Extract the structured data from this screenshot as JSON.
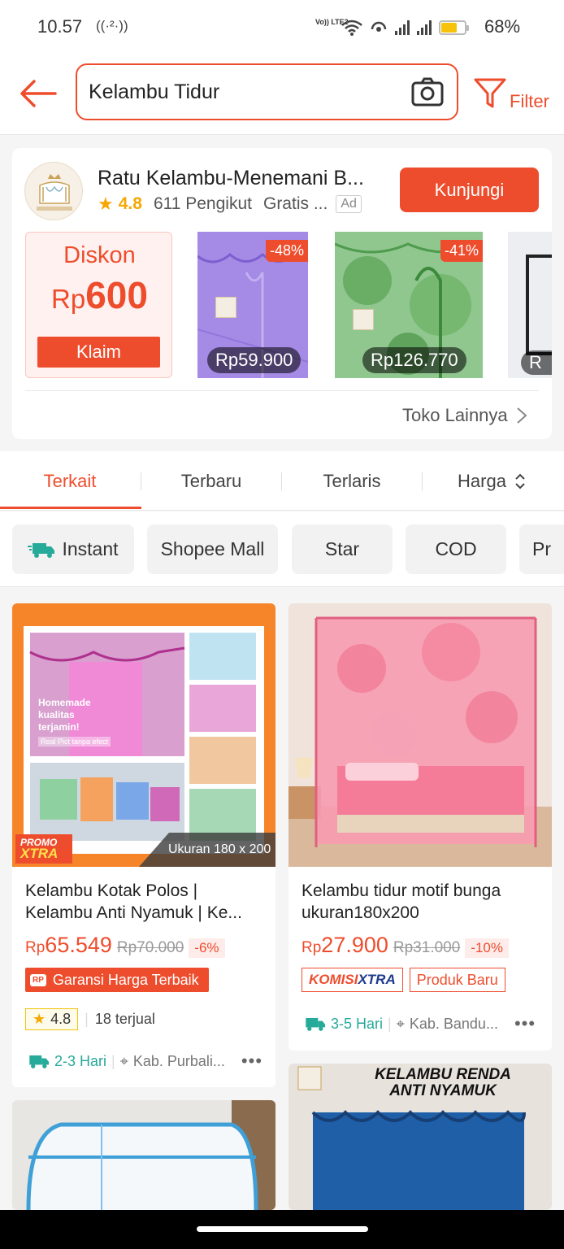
{
  "status_bar": {
    "time": "10.57",
    "ring_icon": "((·²·))",
    "volte": "Vo))\nLTE2",
    "battery_pct": "68%",
    "battery_level": 0.68
  },
  "header": {
    "search_value": "Kelambu Tidur",
    "filter_label": "Filter"
  },
  "shop_ad": {
    "name": "Ratu Kelambu-Menemani B...",
    "rating": "4.8",
    "followers": "611 Pengikut",
    "extra": "Gratis ...",
    "ad_label": "Ad",
    "visit_label": "Kunjungi",
    "voucher": {
      "title": "Diskon",
      "currency": "Rp",
      "amount": "600",
      "claim_label": "Klaim"
    },
    "items": [
      {
        "discount": "-48%",
        "price": "Rp59.900"
      },
      {
        "discount": "-41%",
        "price": "Rp126.770"
      },
      {
        "price": "R"
      }
    ],
    "more_label": "Toko Lainnya"
  },
  "sort_tabs": [
    "Terkait",
    "Terbaru",
    "Terlaris",
    "Harga"
  ],
  "filter_chips": [
    "Instant",
    "Shopee Mall",
    "Star",
    "COD",
    "Pr"
  ],
  "products": [
    {
      "image_caption": "Ukuran 180 x 200",
      "promo_badge_top": "PROMO",
      "promo_badge_bottom": "XTRA",
      "overlay_text": "Homemade kualitas terjamin!",
      "overlay_sub": "Real Pict tanpa efect",
      "title": "Kelambu Kotak Polos | Kelambu Anti Nyamuk | Ke...",
      "currency": "Rp",
      "price": "65.549",
      "original_price": "Rp70.000",
      "discount": "-6%",
      "badge": "Garansi Harga Terbaik",
      "badge_icon_text": "RP",
      "rating": "4.8",
      "sold": "18 terjual",
      "shipping": "2-3 Hari",
      "location": "Kab. Purbali..."
    },
    {
      "title": "Kelambu tidur motif bunga ukuran180x200",
      "currency": "Rp",
      "price": "27.900",
      "original_price": "Rp31.000",
      "discount": "-10%",
      "badge_left": "KOMISI",
      "badge_right": "XTRA",
      "badge2": "Produk Baru",
      "shipping": "3-5 Hari",
      "location": "Kab. Bandu..."
    },
    {
      "title": ""
    },
    {
      "image_heading_line1": "KELAMBU RENDA",
      "image_heading_line2": "ANTI NYAMUK"
    }
  ],
  "colors": {
    "accent": "#ee4d2d",
    "teal": "#26aa99",
    "star": "#f6a700"
  }
}
